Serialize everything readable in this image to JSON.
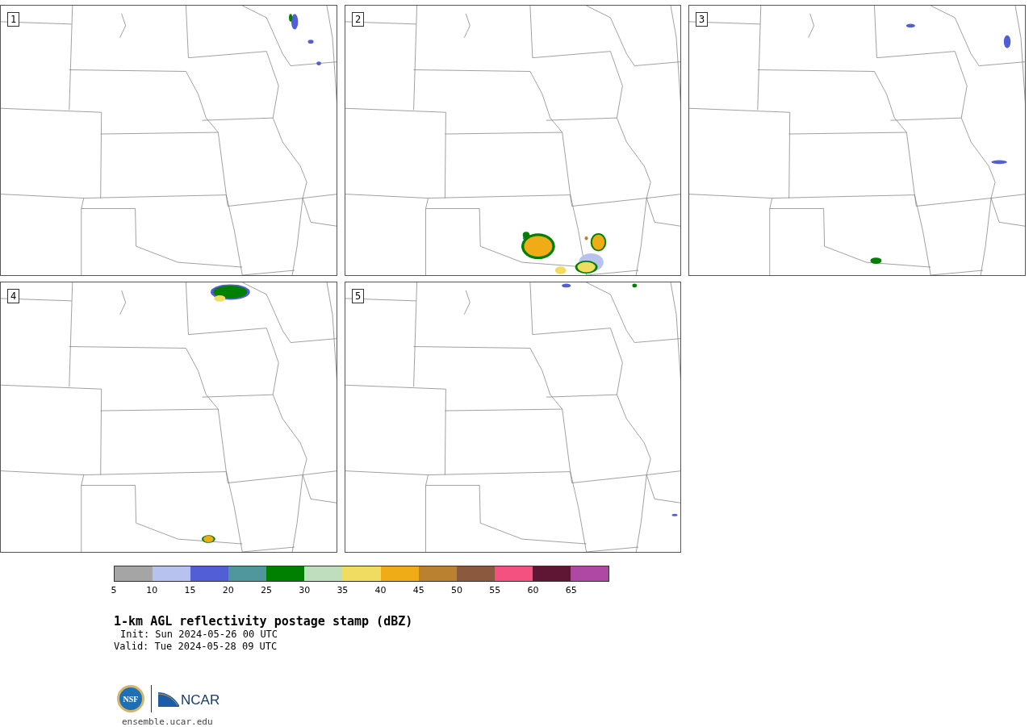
{
  "panels": [
    {
      "number": "1"
    },
    {
      "number": "2"
    },
    {
      "number": "3"
    },
    {
      "number": "4"
    },
    {
      "number": "5"
    }
  ],
  "legend": {
    "bins": [
      {
        "color": "#a5a5a5",
        "label": "5"
      },
      {
        "color": "#b7c2ee",
        "label": "10"
      },
      {
        "color": "#525ed6",
        "label": "15"
      },
      {
        "color": "#4f979c",
        "label": "20"
      },
      {
        "color": "#008000",
        "label": "25"
      },
      {
        "color": "#bedebe",
        "label": "30"
      },
      {
        "color": "#f0dc60",
        "label": "35"
      },
      {
        "color": "#f0ac16",
        "label": "40"
      },
      {
        "color": "#ba8230",
        "label": "45"
      },
      {
        "color": "#8b5a3e",
        "label": "50"
      },
      {
        "color": "#f45180",
        "label": "55"
      },
      {
        "color": "#5e1634",
        "label": "60"
      },
      {
        "color": "#ae48a4",
        "label": "65"
      }
    ]
  },
  "title": "1-km AGL reflectivity postage stamp (dBZ)",
  "init": "Init: Sun 2024-05-26 00 UTC",
  "valid": "Valid: Tue 2024-05-28 09 UTC",
  "logos": {
    "nsf": "NSF",
    "ncar": "NCAR"
  },
  "url": "ensemble.ucar.edu"
}
